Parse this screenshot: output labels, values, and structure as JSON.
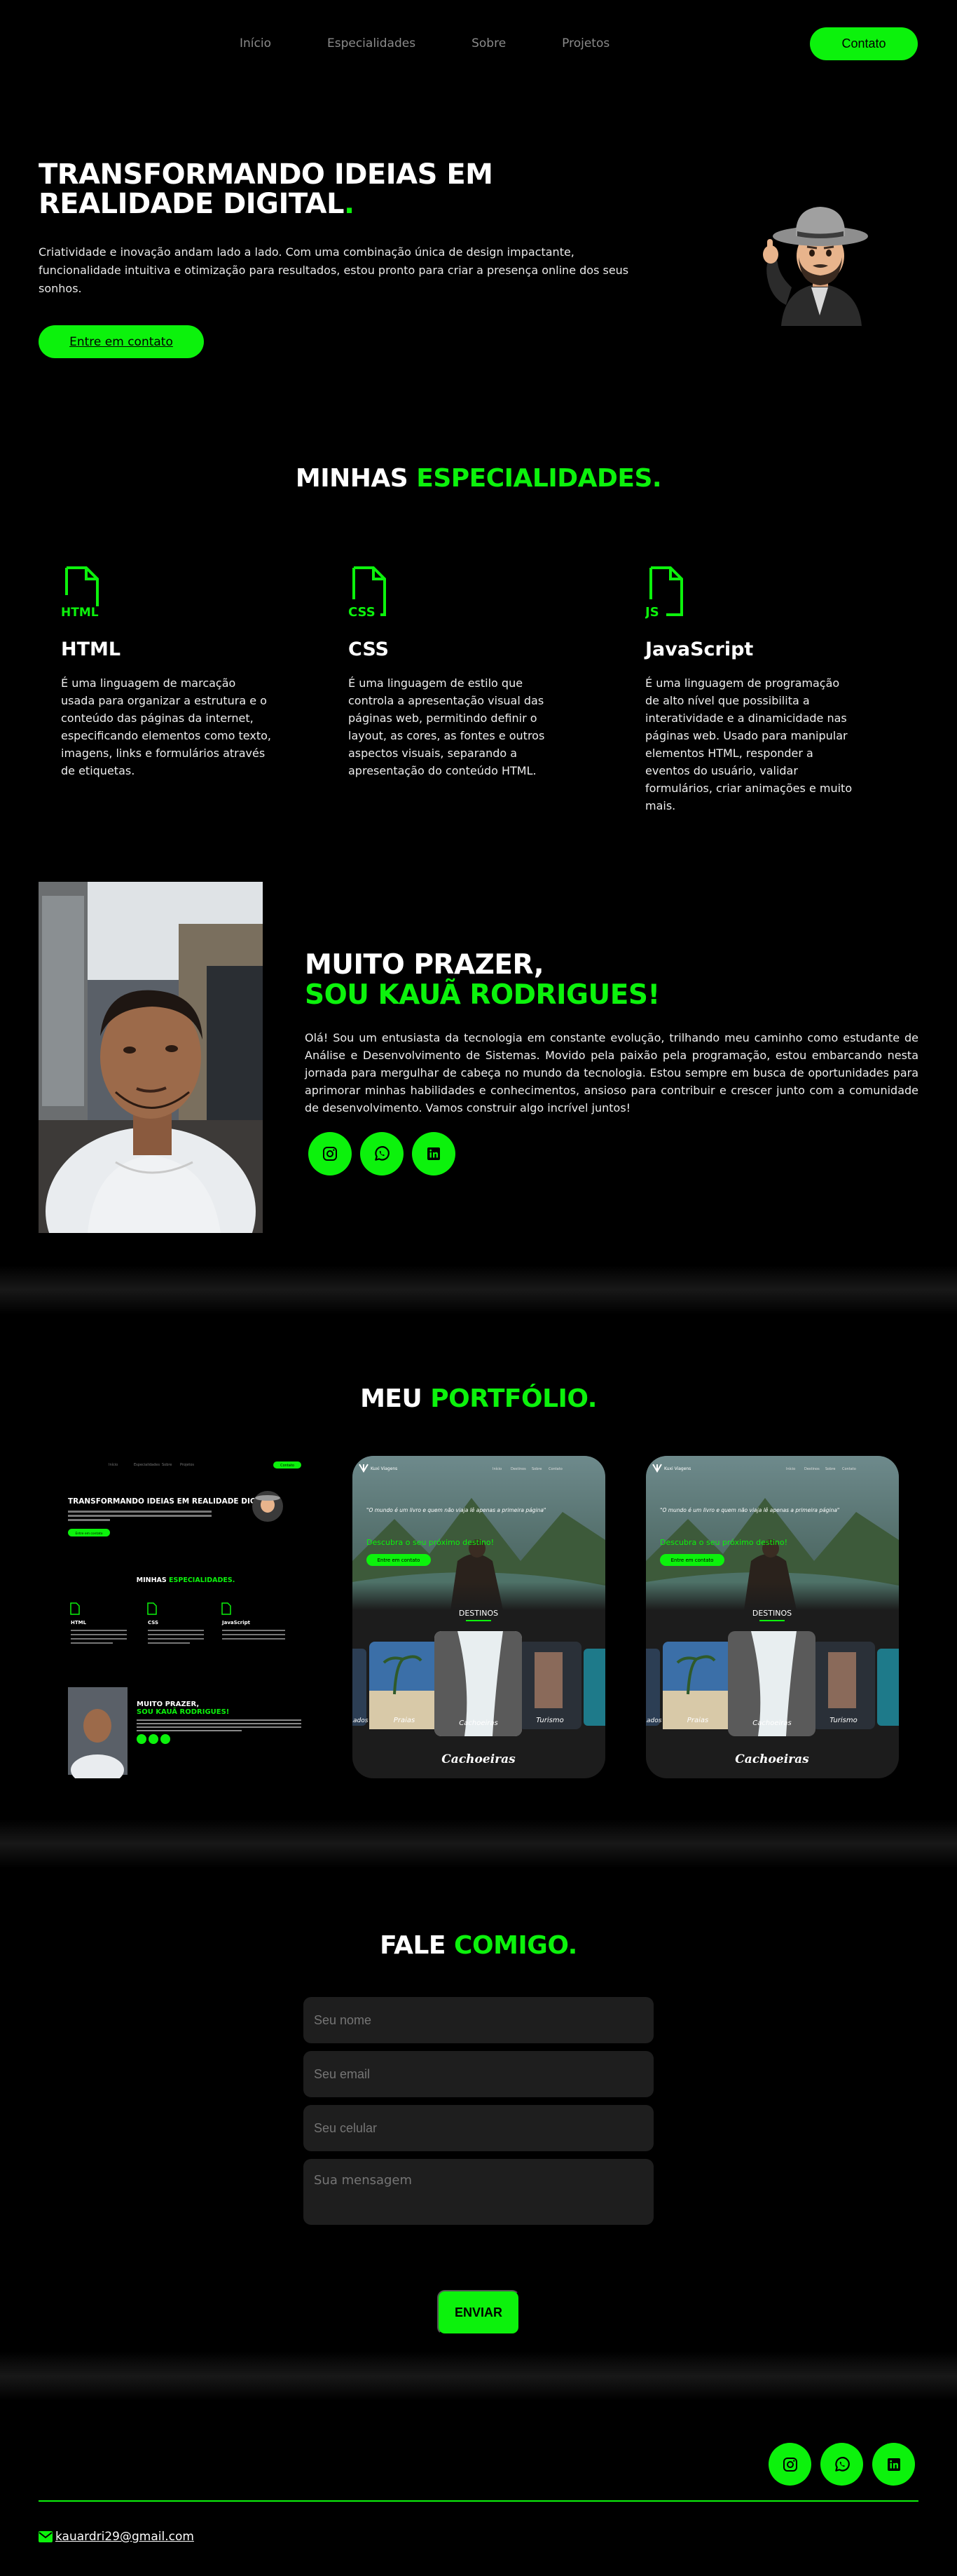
{
  "nav": {
    "links": [
      "Início",
      "Especialidades",
      "Sobre",
      "Projetos"
    ],
    "cta": "Contato"
  },
  "hero": {
    "title": "TRANSFORMANDO IDEIAS EM REALIDADE DIGITAL",
    "title_dot": ".",
    "text": "Criatividade e inovação andam lado a lado. Com uma combinação única de design impactante, funcionalidade intuitiva e otimização para resultados, estou pronto para criar a presença online dos seus sonhos.",
    "button": "Entre em contato"
  },
  "specialties": {
    "title_a": "MINHAS ",
    "title_b": "ESPECIALIDADES.",
    "items": [
      {
        "icon_label": "HTML",
        "name": "HTML",
        "text": "É uma linguagem de marcação usada para organizar a estrutura e o conteúdo das páginas da internet, especificando elementos como texto, imagens, links e formulários através de etiquetas."
      },
      {
        "icon_label": "CSS",
        "name": "CSS",
        "text": "É uma linguagem de estilo que controla a apresentação visual das páginas web, permitindo definir o layout, as cores, as fontes e outros aspectos visuais, separando a apresentação do conteúdo HTML."
      },
      {
        "icon_label": "JS",
        "name": "JavaScript",
        "text": "É uma linguagem de programação de alto nível que possibilita a interatividade e a dinamicidade nas páginas web. Usado para manipular elementos HTML, responder a eventos do usuário, validar formulários, criar animações e muito mais."
      }
    ]
  },
  "about": {
    "title_a": "MUITO PRAZER,",
    "title_b": "SOU KAUÃ RODRIGUES!",
    "text": "Olá! Sou um entusiasta da tecnologia em constante evolução, trilhando meu caminho como estudante de Análise e Desenvolvimento de Sistemas. Movido pela paixão pela programação, estou embarcando nesta jornada para mergulhar de cabeça no mundo da tecnologia. Estou sempre em busca de oportunidades para aprimorar minhas habilidades e conhecimentos, ansioso para contribuir e crescer junto com a comunidade de desenvolvimento. Vamos construir algo incrível juntos!"
  },
  "portfolio": {
    "title_a": "MEU ",
    "title_b": "PORTFÓLIO.",
    "mini": {
      "nav": [
        "Início",
        "Especialidades",
        "Sobre",
        "Projetos"
      ],
      "cta": "Contato",
      "hero_title": "TRANSFORMANDO IDEIAS EM REALIDADE DIGITAL.",
      "hero_btn": "Entre em contato",
      "spec_a": "MINHAS ",
      "spec_b": "ESPECIALIDADES.",
      "spec_names": [
        "HTML",
        "CSS",
        "JavaScript"
      ],
      "about_a": "MUITO PRAZER,",
      "about_b": "SOU KAUÃ RODRIGUES!"
    },
    "travel": {
      "brand": "Kuxi Viagens",
      "nav": [
        "Início",
        "Destinos",
        "Sobre",
        "Contato"
      ],
      "quote": "\"O mundo é um livro e quem não viaja lê apenas a primeira página\"",
      "heading": "Descubra o seu próximo destino!",
      "button": "Entre em contato",
      "section": "DESTINOS",
      "cards": [
        "Praias",
        "Cachoeiras",
        "Turismo"
      ],
      "left_label": "Lados",
      "caption": "Cachoeiras"
    }
  },
  "contact": {
    "title_a": "FALE ",
    "title_b": "COMIGO.",
    "fields": {
      "name": "Seu nome",
      "email": "Seu email",
      "phone": "Seu celular",
      "message": "Sua mensagem"
    },
    "button": "ENVIAR"
  },
  "footer": {
    "email": "kauardri29@gmail.com"
  },
  "colors": {
    "accent": "#0cf20c",
    "background": "#000000",
    "field": "#1e1e1e"
  },
  "icons": [
    "instagram-icon",
    "whatsapp-icon",
    "linkedin-icon",
    "mail-icon",
    "file-code-icon"
  ]
}
